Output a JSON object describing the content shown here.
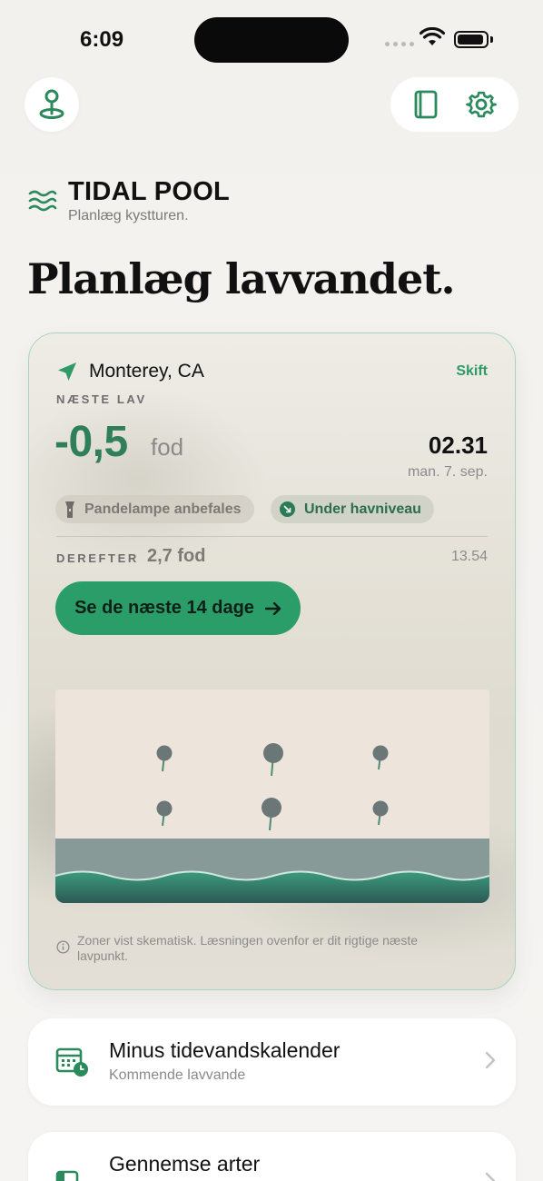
{
  "status_bar": {
    "time": "6:09"
  },
  "app": {
    "name": "TIDAL POOL",
    "tagline": "Planlæg kystturen.",
    "headline": "Planlæg lavvandet."
  },
  "colors": {
    "accent": "#2e9a66",
    "accent_dark": "#2f7f58",
    "cta": "#2b9d69"
  },
  "icons": {
    "top_left": "map-pin-icon",
    "top_right": [
      "book-icon",
      "gear-icon"
    ],
    "brand": "waves-icon",
    "location": "location-arrow-icon"
  },
  "tide_card": {
    "location": "Monterey, CA",
    "change_label": "Skift",
    "next_low_label": "NÆSTE LAV",
    "next_low_value": "-0,5",
    "next_low_unit": "fod",
    "next_low_time": "02.31",
    "next_low_date": "man. 7. sep.",
    "chips": [
      {
        "label": "Pandelampe anbefales",
        "icon": "flashlight-icon"
      },
      {
        "label": "Under havniveau",
        "icon": "arrow-down-right-icon"
      }
    ],
    "then_label": "DEREFTER",
    "then_value": "2,7 fod",
    "then_time": "13.54",
    "cta_label": "Se de næste 14 dage",
    "zone_note": "Zoner vist skematisk. Læsningen ovenfor er dit rigtige næste lavpunkt."
  },
  "list": [
    {
      "title": "Minus tidevandskalender",
      "subtitle": "Kommende lavvande",
      "icon": "calendar-clock-icon"
    },
    {
      "title": "Gennemse arter",
      "subtitle": "",
      "icon": "book-icon"
    }
  ]
}
